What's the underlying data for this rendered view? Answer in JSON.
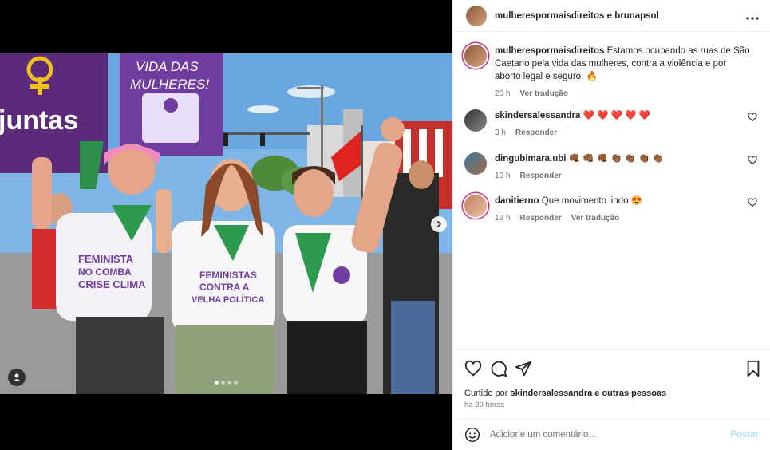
{
  "post": {
    "header_names": "mulherespormaisdireitos e brunapsol",
    "caption": {
      "username": "mulherespormaisdireitos",
      "text": "Estamos ocupando as ruas de São Caetano pela vida das mulheres, contra a violência e por aborto legal e seguro! 🔥",
      "time": "20 h",
      "translate": "Ver tradução"
    },
    "photo": {
      "flag_text": "juntas",
      "sign_line1": "VIDA DAS",
      "sign_line2": "MULHERES!",
      "shirt1_line1": "FEMINISTA",
      "shirt1_line2": "NO COMBA",
      "shirt1_line3": "CRISE CLIMA",
      "shirt2_line1": "FEMINISTAS",
      "shirt2_line2": "CONTRA A",
      "shirt2_line3": "VELHA POLÍTICA"
    },
    "comments": [
      {
        "username": "skindersalessandra",
        "text": "❤️ ❤️ ❤️ ❤️ ❤️",
        "time": "3 h",
        "reply": "Responder",
        "translate": ""
      },
      {
        "username": "dingubimara.ubi",
        "text": "👊🏾 👊🏾 👊🏾 👏🏾 👏🏾 👏🏾 👏🏾",
        "time": "10 h",
        "reply": "Responder",
        "translate": ""
      },
      {
        "username": "danitierno",
        "text": "Que movimento lindo 😍",
        "time": "19 h",
        "reply": "Responder",
        "translate": "Ver tradução"
      }
    ],
    "liked_by_prefix": "Curtido por",
    "liked_by_user": "skindersalessandra",
    "liked_by_suffix": "e outras pessoas",
    "timestamp": "há 20 horas",
    "comment_placeholder": "Adicione um comentário...",
    "post_label": "Postar"
  },
  "icons": [
    "more-icon",
    "heart-icon",
    "comment-icon",
    "share-icon",
    "bookmark-icon",
    "emoji-icon",
    "chevron-right-icon",
    "tag-user-icon"
  ],
  "colors": {
    "story_ring": "#d62976",
    "post_button": "#b3dbff",
    "muted": "#737373"
  }
}
